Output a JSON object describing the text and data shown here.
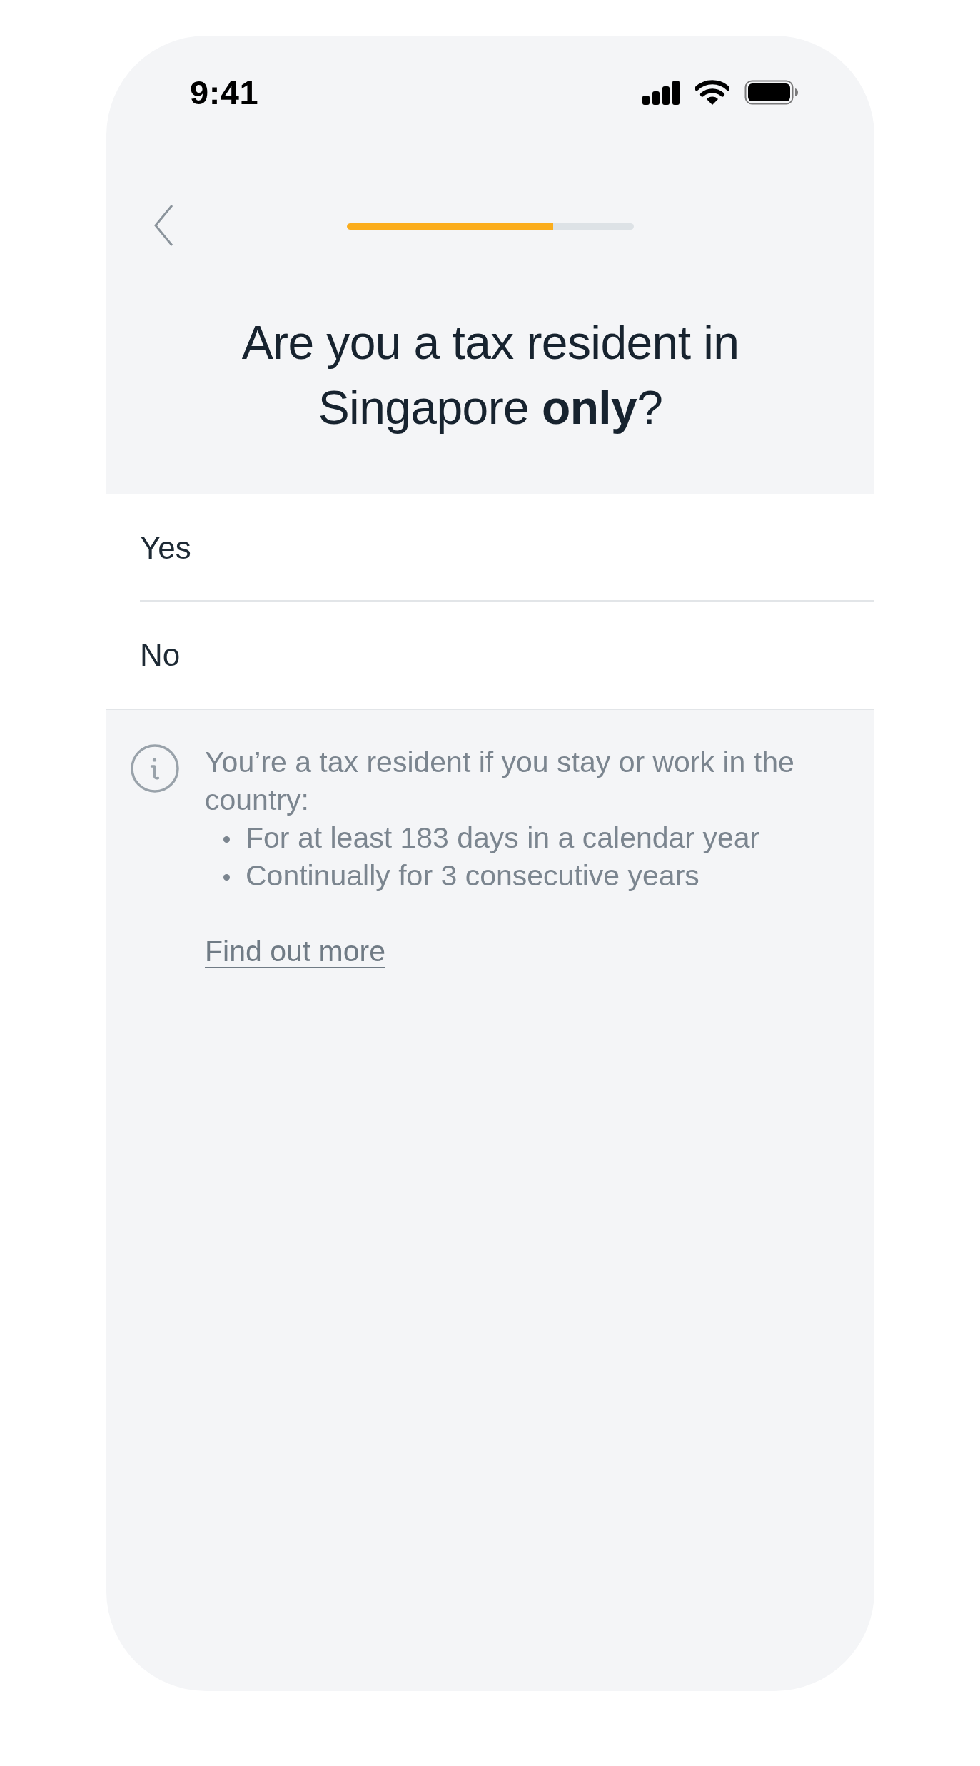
{
  "status_bar": {
    "time": "9:41"
  },
  "header": {
    "progress": {
      "level": 0.72
    }
  },
  "title": "Are you a tax resident in Singapore **only**?",
  "options": [
    {
      "label": "Yes",
      "selected": false
    },
    {
      "label": "No",
      "selected": false
    }
  ],
  "info": {
    "text": "You’re a tax resident if you stay or work in the country:",
    "bullets": [
      "For at least 183 days in a calendar year",
      "Continually for 3 consecutive years"
    ],
    "link": "Find out more"
  }
}
